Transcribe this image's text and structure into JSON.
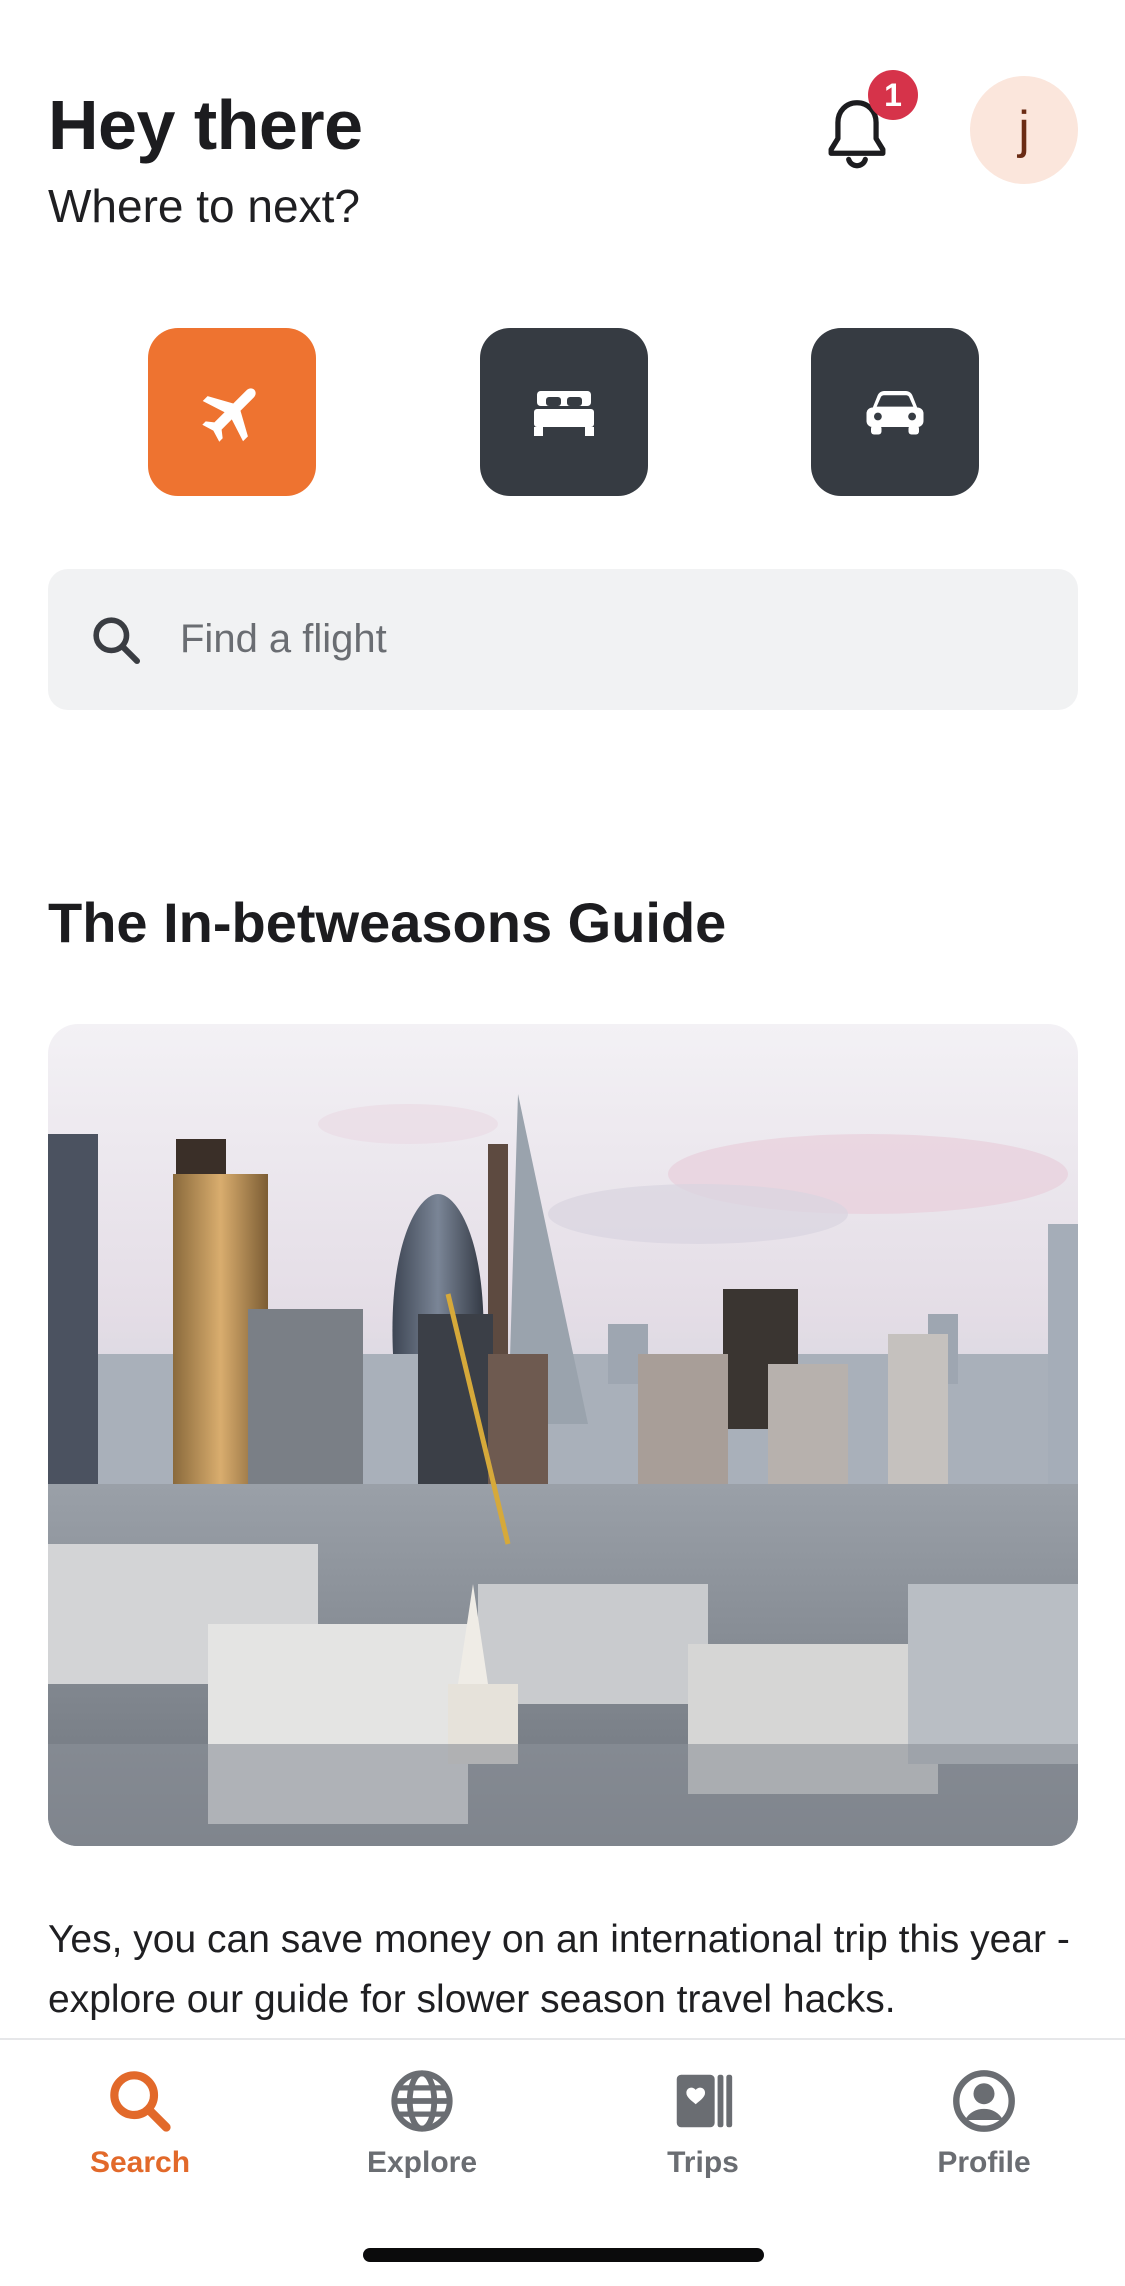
{
  "header": {
    "greeting": "Hey there",
    "subtitle": "Where to next?",
    "notification_count": "1",
    "avatar_initial": "j"
  },
  "categories": [
    {
      "icon": "airplane-icon",
      "selected": true
    },
    {
      "icon": "bed-icon",
      "selected": false
    },
    {
      "icon": "car-icon",
      "selected": false
    }
  ],
  "search": {
    "icon": "search-icon",
    "placeholder": "Find a flight"
  },
  "guide": {
    "title": "The In-betweasons Guide",
    "image": "city-skyline-photo",
    "description": "Yes, you can save money on an international trip this year - explore our guide for slower season travel hacks."
  },
  "tabs": [
    {
      "label": "Search",
      "icon": "search-icon",
      "active": true
    },
    {
      "label": "Explore",
      "icon": "globe-icon",
      "active": false
    },
    {
      "label": "Trips",
      "icon": "trips-icon",
      "active": false
    },
    {
      "label": "Profile",
      "icon": "profile-icon",
      "active": false
    }
  ],
  "colors": {
    "accent": "#ee7330",
    "dark_button": "#363b42",
    "badge": "#d6334a",
    "avatar_bg": "#fbe6dc",
    "search_bg": "#f1f2f3",
    "tab_active": "#e2692a",
    "tab_inactive": "#6a6d72"
  }
}
